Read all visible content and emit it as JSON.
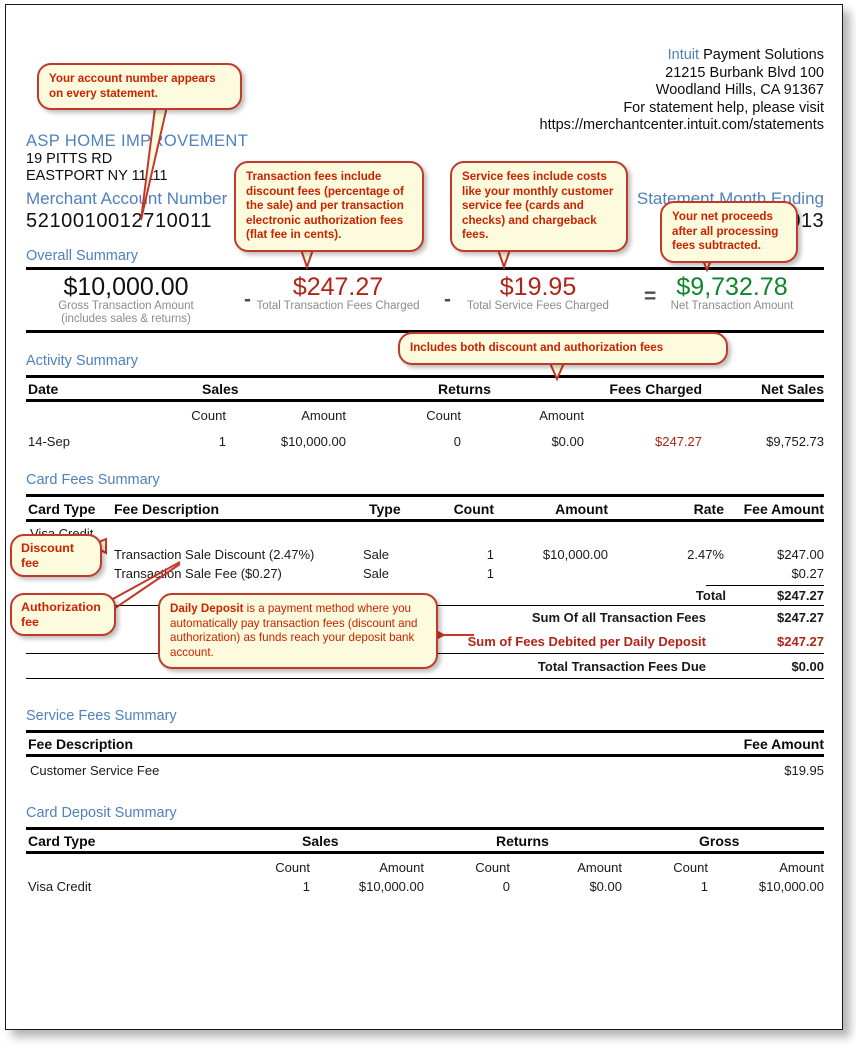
{
  "document": {
    "type": "merchant-statement",
    "colors": {
      "heading_blue": "#4f81bd",
      "callout_red": "#cc2200",
      "callout_fill": "#fcfbdd",
      "amount_red": "#b02418",
      "amount_green": "#11842b"
    }
  },
  "header": {
    "company_brand": "Intuit",
    "company_rest": " Payment Solutions",
    "address_line1": "21215 Burbank Blvd 100",
    "address_line2": "Woodland Hills, CA 91367",
    "help_line": "For statement help, please visit",
    "help_url": "https://merchantcenter.intuit.com/statements",
    "merchant_name": "ASP  HOME IMPROVEMENT",
    "merchant_address1": "19  PITTS RD",
    "merchant_address2": "EASTPORT NY 11111",
    "merchant_account_label": "Merchant Account Number",
    "merchant_account_number": "5210010012710011",
    "statement_month_label": "Statement Month Ending",
    "statement_month_value": "2013"
  },
  "overall_summary": {
    "title": "Overall Summary",
    "items": [
      {
        "amount": "$10,000.00",
        "label_line1": "Gross Transaction Amount",
        "label_line2": "(includes sales & returns)",
        "color": "black"
      },
      {
        "amount": "$247.27",
        "label_line1": "Total Transaction Fees Charged",
        "label_line2": "",
        "color": "red"
      },
      {
        "amount": "$19.95",
        "label_line1": "Total Service Fees Charged",
        "label_line2": "",
        "color": "red"
      },
      {
        "amount": "$9,732.78",
        "label_line1": "Net Transaction Amount",
        "label_line2": "",
        "color": "green"
      }
    ],
    "operators": [
      "-",
      "-",
      "="
    ]
  },
  "activity_summary": {
    "title": "Activity Summary",
    "group_headers": [
      "Date",
      "Sales",
      "Returns",
      "Fees Charged",
      "Net Sales"
    ],
    "sub_headers": [
      "Count",
      "Amount",
      "Count",
      "Amount"
    ],
    "rows": [
      {
        "date": "14-Sep",
        "sales_count": "1",
        "sales_amount": "$10,000.00",
        "returns_count": "0",
        "returns_amount": "$0.00",
        "fees_charged": "$247.27",
        "net_sales": "$9,752.73"
      }
    ]
  },
  "card_fees_summary": {
    "title": "Card Fees Summary",
    "headers": [
      "Card Type",
      "Fee Description",
      "Type",
      "Count",
      "Amount",
      "Rate",
      "Fee Amount"
    ],
    "card_type": "Visa Credit",
    "rows": [
      {
        "description": "Transaction Sale Discount (2.47%)",
        "type": "Sale",
        "count": "1",
        "amount": "$10,000.00",
        "rate": "2.47%",
        "fee_amount": "$247.00"
      },
      {
        "description": "Transaction Sale Fee ($0.27)",
        "type": "Sale",
        "count": "1",
        "amount": "",
        "rate": "",
        "fee_amount": "$0.27"
      }
    ],
    "total_label": "Total",
    "total_value": "$247.27",
    "summary_lines": [
      {
        "label": "Sum Of all Transaction Fees",
        "value": "$247.27",
        "style": "black"
      },
      {
        "label": "Sum of Fees Debited per Daily Deposit",
        "value": "$247.27",
        "style": "red"
      },
      {
        "label": "Total Transaction Fees Due",
        "value": "$0.00",
        "style": "black"
      }
    ]
  },
  "service_fees_summary": {
    "title": "Service Fees Summary",
    "headers": [
      "Fee Description",
      "Fee Amount"
    ],
    "rows": [
      {
        "description": "Customer Service Fee",
        "amount": "$19.95"
      }
    ]
  },
  "card_deposit_summary": {
    "title": "Card Deposit Summary",
    "group_headers": [
      "Card Type",
      "Sales",
      "Returns",
      "Gross"
    ],
    "sub_headers": [
      "Count",
      "Amount",
      "Count",
      "Amount",
      "Count",
      "Amount"
    ],
    "rows": [
      {
        "card_type": "Visa Credit",
        "sales_count": "1",
        "sales_amount": "$10,000.00",
        "returns_count": "0",
        "returns_amount": "$0.00",
        "gross_count": "1",
        "gross_amount": "$10,000.00"
      }
    ]
  },
  "callouts": {
    "account_number": "Your account number appears on every statement.",
    "transaction_fees": "Transaction fees include discount fees (percentage of the sale) and per transaction electronic authorization fees (flat fee in cents).",
    "service_fees": "Service fees include costs like your monthly customer service fee (cards and checks) and chargeback fees.",
    "net_proceeds": "Your net proceeds after all processing fees subtracted.",
    "fees_charged": "Includes both discount and authorization fees",
    "discount_fee": "Discount fee",
    "authorization_fee": "Authorization fee",
    "daily_deposit_bold": "Daily Deposit",
    "daily_deposit_rest": " is a payment method where you automatically pay transaction fees (discount and authorization) as funds reach your deposit bank account."
  }
}
